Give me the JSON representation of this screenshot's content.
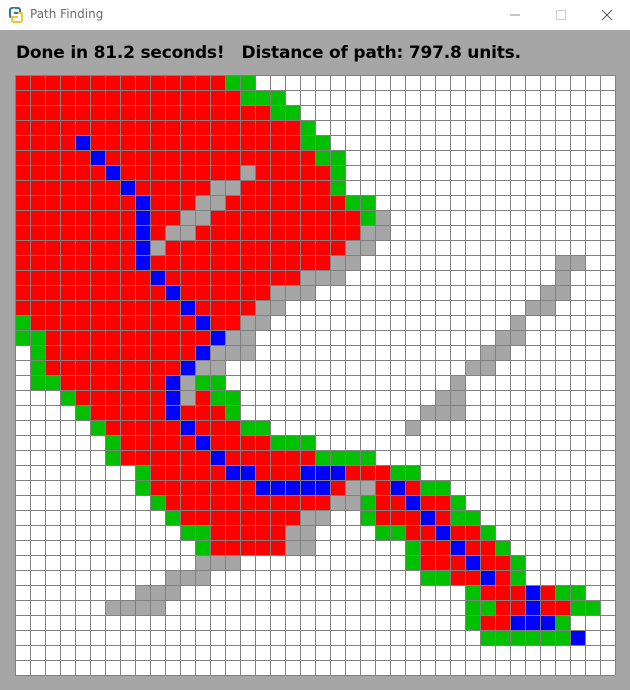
{
  "window": {
    "title": "Path Finding",
    "icon": "python-snake-icon"
  },
  "status": {
    "text": "Done in 81.2 seconds!   Distance of path: 797.8 units."
  },
  "grid": {
    "cols": 40,
    "rows": 40,
    "colors": {
      "empty": "#ffffff",
      "wall": "#a6a6a6",
      "closed": "#ff0000",
      "open": "#00c000",
      "path": "#0000ff",
      "line": "#808080"
    },
    "legend": {
      "#": "wall",
      "R": "closed",
      "G": "open",
      "B": "path",
      ".": "empty"
    },
    "cells": [
      "RRRRRRRRRRRRRRGG........................",
      "RRRRRRRRRRRRRRRGGG......................",
      "RRRRRRRRRRRRRRRRRGG.....................",
      "RRRRRRRRRRRRRRRRRRRG....................",
      "RRRRBRRRRRRRRRRRRRRGG...................",
      "RRRRRBRRRRRRRRRRRRRRGG..................",
      "RRRRRRBRRRRRRRR#RRRRRG..................",
      "RRRRRRRBRRRRR##RRRRRRG..................",
      "RRRRRRRRBRRR##RRRRRRRRGG................",
      "RRRRRRRRBRR##RRRRRRRRRRG#...............",
      "RRRRRRRRBR##RRRRRRRRRRR##...............",
      "RRRRRRRRB#RRRRRRRRRRRR##................",
      "RRRRRRRRBRRRRRRRRRRRR##.............##..",
      "RRRRRRRRRBRRRRRRRRR###..............#...",
      "RRRRRRRRRRBRRRRRR###...............##...",
      "RRRRRRRRRRRBRRRR##................##....",
      "GRRRRRRRRRRRBRR##................#.....",
      "GGRRRRRRRRRRRB##................##......",
      ".GRRRRRRRRRRB###...............##.......",
      ".GRRRRRRRRRB##................##........",
      ".GGRRRRRRRB#GG...............#.........",
      "...GRRRRRRB#RGG.............##.........",
      "....GRRRRRBRRRG............###.........",
      ".....GRRRRRBRRRGG.........#............",
      "......GRRRRRBRRRRGGG...................",
      "......GRRRRRRBRRRRRRGGGG...............",
      "........GRRRRRBBRRRBBBRRRGG............",
      "........GRRRRRRRBBBBBR##RBRGG..........",
      ".........GRRRRRRRRRRR##GRRBRRG.........",
      "..........GRRRRRRRR##..GRRRBRGG........",
      "...........GGRRRRR##....GGRRBRRG.......",
      "............GRRRRR##......GRRBRRG......",
      "............###...........GRRRBRRG.....",
      "..........###..............GGRRBRG.....",
      "........###...................GRRRBRGG..",
      "......####....................GGRRBRRGG.",
      "..............................GRRBBBG...",
      "...............................GGGGGGB..",
      "........................................",
      "........................................"
    ]
  }
}
